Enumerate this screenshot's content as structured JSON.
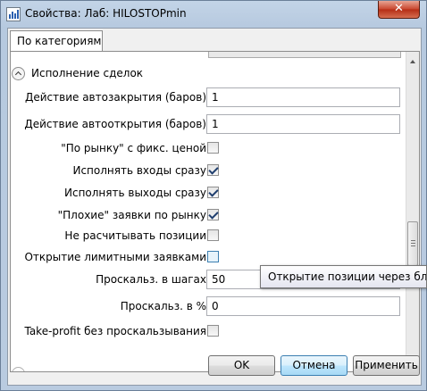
{
  "window": {
    "title": "Свойства: Лаб: HILOSTOPmin",
    "close_glyph": "✕",
    "accent": "#c8452d"
  },
  "tab": {
    "label": "По категориям"
  },
  "section": {
    "label": "Исполнение сделок"
  },
  "rows": [
    {
      "label": "Действие автозакрытия (баров)",
      "value": "1"
    },
    {
      "label": "Действие автооткрытия (баров)",
      "value": "1"
    },
    {
      "label": "\"По рынку\" с фикс. ценой",
      "checked": false
    },
    {
      "label": "Исполнять входы сразу",
      "checked": true
    },
    {
      "label": "Исполнять выходы сразу",
      "checked": true
    },
    {
      "label": "\"Плохие\" заявки по рынку",
      "checked": true
    },
    {
      "label": "Не расчитывать позиции",
      "checked": false
    },
    {
      "label": "Открытие лимитными заявками",
      "checked": false
    },
    {
      "label": "Проскальз. в шагах",
      "value": "50"
    },
    {
      "label": "Проскальз. в %",
      "value": "0"
    },
    {
      "label": "Take-profit без проскальзывания",
      "checked": false
    }
  ],
  "tooltip": {
    "text": "Открытие позиции через блоки Ф"
  },
  "buttons": {
    "ok": "OK",
    "cancel": "Отмена",
    "apply": "Применить"
  }
}
